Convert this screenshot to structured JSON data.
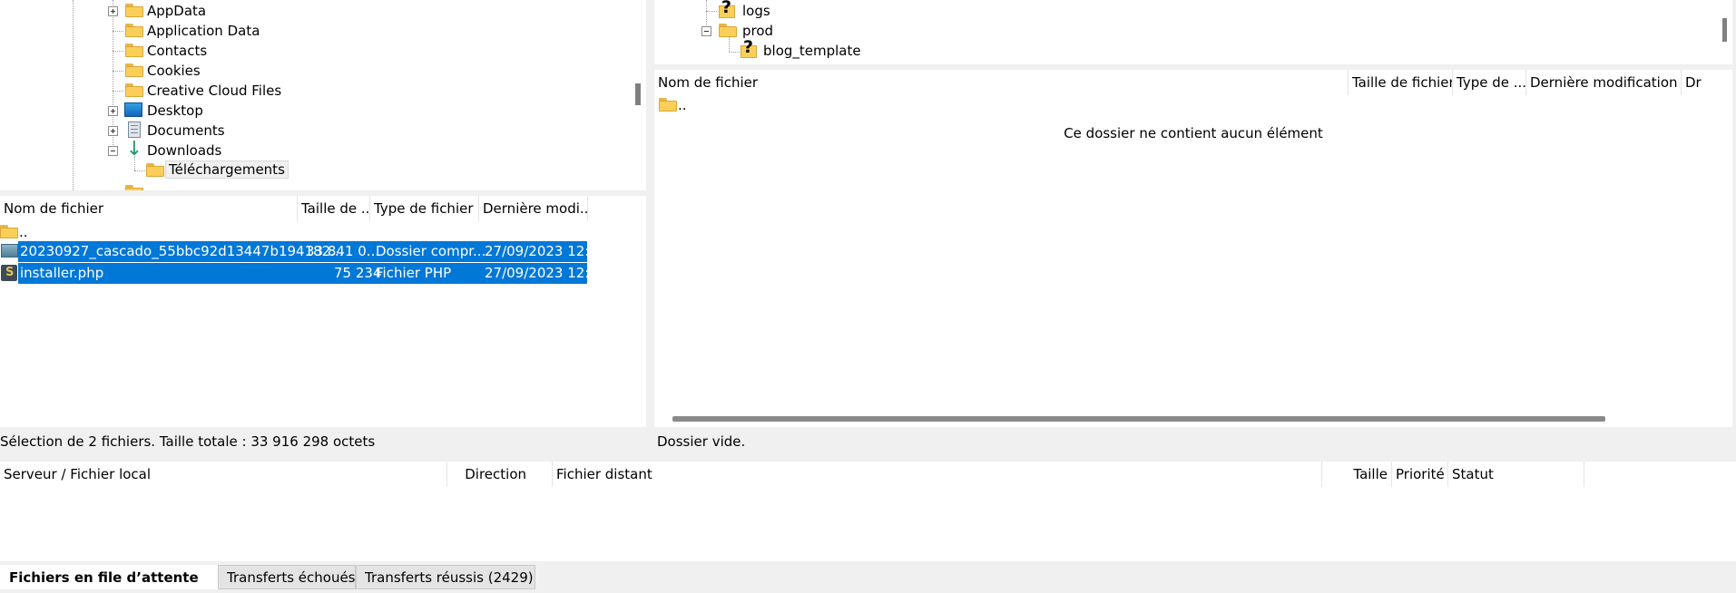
{
  "local_tree": {
    "items": [
      {
        "label": "AppData"
      },
      {
        "label": "Application Data"
      },
      {
        "label": "Contacts"
      },
      {
        "label": "Cookies"
      },
      {
        "label": "Creative Cloud Files"
      },
      {
        "label": "Desktop"
      },
      {
        "label": "Documents"
      },
      {
        "label": "Downloads"
      },
      {
        "label": "Téléchargements"
      }
    ]
  },
  "remote_tree": {
    "items": [
      {
        "label": "logs"
      },
      {
        "label": "prod"
      },
      {
        "label": "blog_template"
      }
    ]
  },
  "local_list": {
    "headers": [
      "Nom de fichier",
      "Taille de ...",
      "Type de fichier",
      "Dernière modi..."
    ],
    "parent": "..",
    "rows": [
      {
        "name": "20230927_cascado_55bbc92d13447b194182...",
        "size": "33 841 0...",
        "type": "Dossier compr...",
        "date": "27/09/2023 12:..."
      },
      {
        "name": "installer.php",
        "size": "75 234",
        "type": "Fichier PHP",
        "date": "27/09/2023 12:..."
      }
    ],
    "status": "Sélection de 2 fichiers. Taille totale : 33 916 298 octets"
  },
  "remote_list": {
    "headers": [
      "Nom de fichier",
      "Taille de fichier",
      "Type de ...",
      "Dernière modification",
      "Dr"
    ],
    "parent": "..",
    "empty_message": "Ce dossier ne contient aucun élément",
    "status": "Dossier vide."
  },
  "queue": {
    "headers": [
      "Serveur / Fichier local",
      "Direction",
      "Fichier distant",
      "Taille",
      "Priorité",
      "Statut"
    ]
  },
  "tabs": [
    {
      "label": "Fichiers en file d’attente",
      "active": true
    },
    {
      "label": "Transferts échoués",
      "active": false
    },
    {
      "label": "Transferts réussis (2429)",
      "active": false
    }
  ],
  "colors": {
    "selection": "#0078d7",
    "folder": "#f9cf59"
  },
  "icons": [
    "folder-icon",
    "question-folder-icon",
    "desktop-icon",
    "documents-icon",
    "downloads-icon",
    "zip-file-icon",
    "php-file-icon"
  ]
}
